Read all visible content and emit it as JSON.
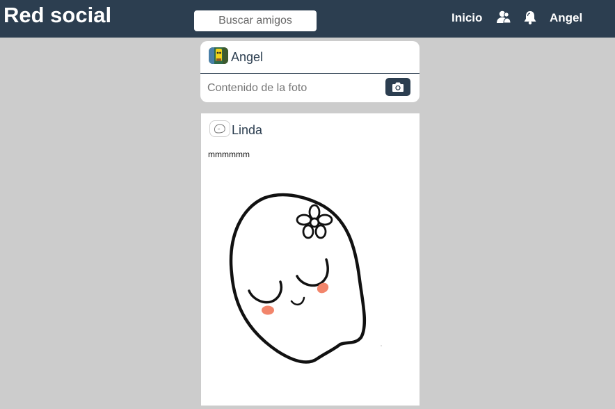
{
  "header": {
    "brand": "Red social",
    "search_placeholder": "Buscar amigos",
    "nav_home": "Inicio",
    "nav_user": "Angel",
    "friends_icon": "friends-icon",
    "bell_icon": "bell-icon",
    "bar_color": "#2c3e50"
  },
  "composer": {
    "username": "Angel",
    "photo_placeholder": "Contenido de la foto",
    "camera_icon": "camera-icon"
  },
  "post": {
    "author": "Linda",
    "text": "mmmmmm",
    "image": "ghost-illustration"
  }
}
